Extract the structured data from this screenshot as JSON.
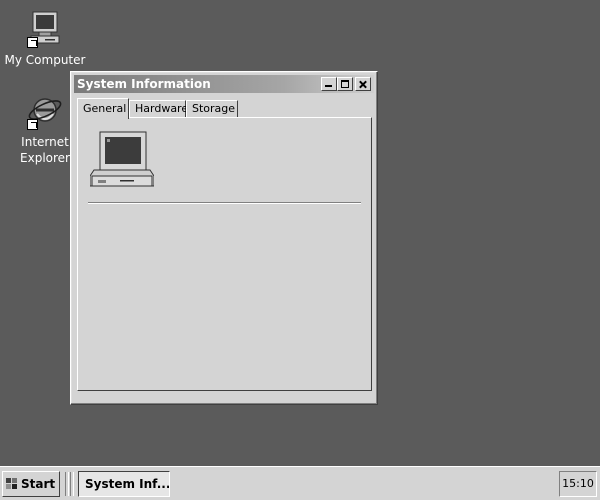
{
  "desktop": {
    "icons": [
      {
        "label": "My Computer",
        "icon": "my-computer-icon"
      },
      {
        "label": "Internet\nExplorer",
        "line1": "Internet",
        "line2": "Explorer",
        "icon": "internet-explorer-icon"
      }
    ]
  },
  "window": {
    "title": "System Information",
    "tabs": [
      {
        "label": "General",
        "active": true
      },
      {
        "label": "Hardware",
        "active": false
      },
      {
        "label": "Storage",
        "active": false
      }
    ],
    "panel_icon": "computer-icon"
  },
  "taskbar": {
    "start_label": "Start",
    "task_label": "System Inf...",
    "clock": "15:10"
  },
  "colors": {
    "desktop": "#5b5b5b",
    "face": "#d4d4d4",
    "titlebar": "#808080"
  }
}
